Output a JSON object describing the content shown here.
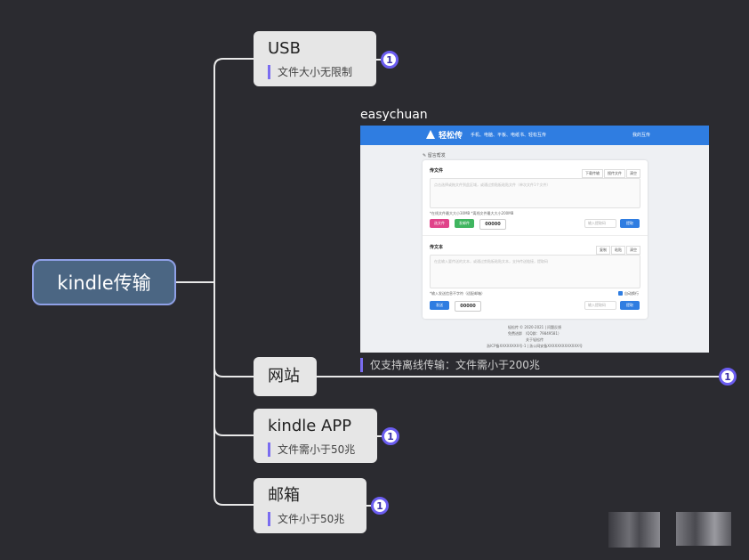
{
  "root": {
    "label": "kindle传输"
  },
  "branches": [
    {
      "title": "USB",
      "note": "文件大小无限制",
      "badge": "1"
    },
    {
      "title": "网站",
      "note": "仅支持离线传输：文件需小于200兆",
      "badge": "1",
      "image_caption": "easychuan"
    },
    {
      "title": "kindle APP",
      "note": "文件需小于50兆",
      "badge": "1"
    },
    {
      "title": "邮箱",
      "note": "文件小于50兆",
      "badge": "1"
    }
  ],
  "screenshot": {
    "brand": "轻松传",
    "nav_links": "手机、电脑、平板、电纸书、轻松互传",
    "nav_right": "我的互传",
    "hint": "✎ 留言帮发",
    "file_section": {
      "title": "传文件",
      "tabs": [
        "下载传输",
        "搜传文件",
        "清空"
      ],
      "placeholder": "点击选择或拖文件到此区域，或通过剪贴板粘贴文件（单次文件1个文件）",
      "limit": "*在线文件最大大小30MB  *离线文件最大大小200MB",
      "btn_select": "选文件",
      "btn_send": "发邮件",
      "code": "00000",
      "input": "输入提取码",
      "get": "提取"
    },
    "text_section": {
      "title": "传文本",
      "tabs": [
        "复制",
        "粘贴",
        "清空"
      ],
      "placeholder": "在此输入要传送的文本，或通过剪贴板粘贴文本，支持传送链接，提取码",
      "limit": "*输入发送信息不字符（适配邮箱）",
      "auto": "自动换行",
      "btn_send": "发送",
      "code": "00000",
      "input": "输入提取码",
      "get": "提取"
    },
    "footer": [
      "轻松传 © 2020-2021 | 问题反馈",
      "免费进群 （QQ群：79849581）",
      "关于轻松传",
      "浙ICP备XXXXXXXX号-1 | 浙公网安备XXXXXXXXXXXXX号"
    ]
  },
  "colors": {
    "background": "#2b2b30",
    "root_fill": "#4b6683",
    "root_border": "#8fa0e6",
    "node_fill": "#e6e6e6",
    "accent": "#7a6cf0",
    "connector": "#e8e8e8",
    "site_blue": "#2f7de1"
  }
}
